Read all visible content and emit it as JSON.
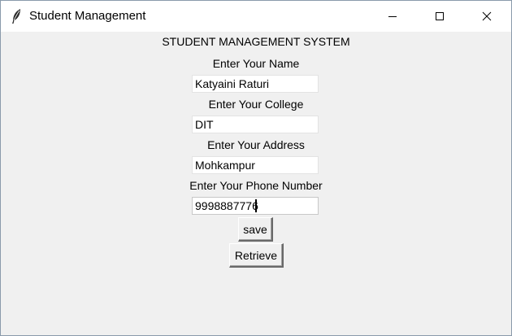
{
  "window": {
    "title": "Student Management",
    "icon": "feather-icon",
    "controls": {
      "minimize_icon": "minimize-icon",
      "maximize_icon": "maximize-icon",
      "close_icon": "close-icon"
    }
  },
  "form": {
    "heading": "STUDENT MANAGEMENT SYSTEM",
    "name_label": "Enter Your Name",
    "name_value": "Katyaini Raturi",
    "college_label": "Enter Your College",
    "college_value": "DIT",
    "address_label": "Enter Your Address",
    "address_value": "Mohkampur",
    "phone_label": "Enter Your Phone Number",
    "phone_value": "9998887776",
    "save_label": "save",
    "retrieve_label": "Retrieve"
  },
  "colors": {
    "window_bg": "#f0f0f0",
    "titlebar_bg": "#ffffff",
    "entry_bg": "#ffffff"
  }
}
